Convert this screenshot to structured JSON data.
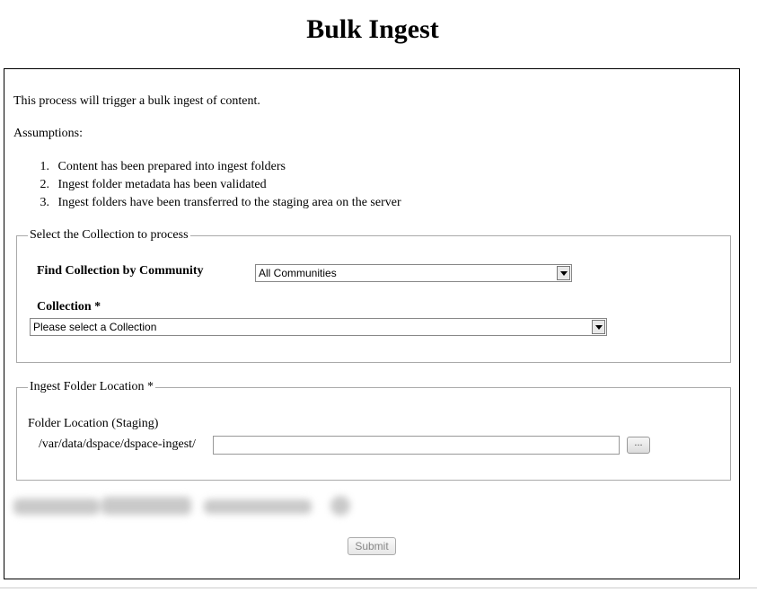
{
  "page": {
    "title": "Bulk Ingest"
  },
  "intro": "This process will trigger a bulk ingest of content.",
  "assumptions_label": "Assumptions:",
  "assumptions": [
    {
      "num": "1.",
      "text": "Content has been prepared into ingest folders"
    },
    {
      "num": "2.",
      "text": "Ingest folder metadata has been validated"
    },
    {
      "num": "3.",
      "text": "Ingest folders have been transferred to the staging area on the server"
    }
  ],
  "collection_section": {
    "legend": "Select the Collection to process",
    "community_label": "Find Collection by Community",
    "community_selected": "All Communities",
    "collection_label": "Collection *",
    "collection_selected": "Please select a Collection"
  },
  "folder_section": {
    "legend": "Ingest Folder Location *",
    "folder_label": "Folder Location (Staging)",
    "path_prefix": "/var/data/dspace/dspace-ingest/",
    "folder_value": "",
    "browse_label": "..."
  },
  "submit_label": "Submit"
}
